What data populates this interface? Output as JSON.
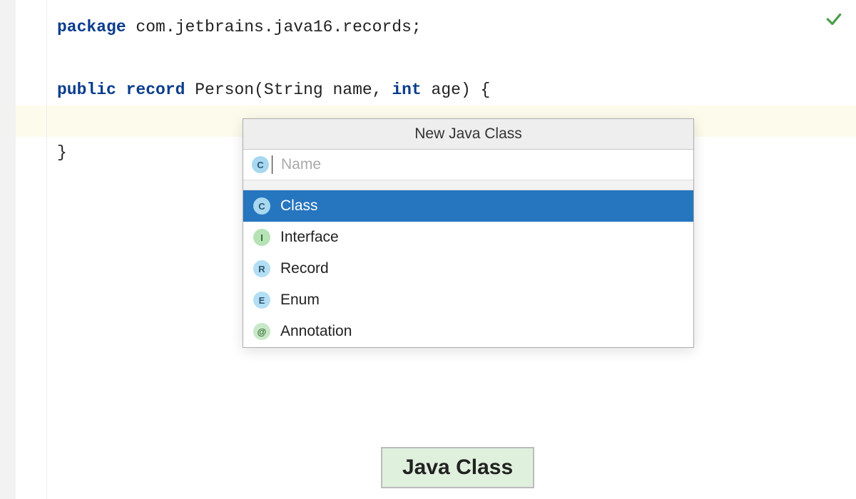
{
  "code": {
    "package_kw": "package",
    "package_name": " com.jetbrains.java16.records;",
    "public_kw": "public",
    "record_kw": " record",
    "record_sig_1": " Person(String name, ",
    "int_kw": "int",
    "record_sig_2": " age) {",
    "close_brace": "}"
  },
  "status": {
    "ok_color": "#4a9e4a"
  },
  "dialog": {
    "title": "New Java Class",
    "input_placeholder": "Name",
    "input_value": "",
    "input_icon_letter": "C",
    "items": [
      {
        "icon_letter": "C",
        "icon_class": "icon-c",
        "label": "Class",
        "selected": true
      },
      {
        "icon_letter": "I",
        "icon_class": "icon-i",
        "label": "Interface",
        "selected": false
      },
      {
        "icon_letter": "R",
        "icon_class": "icon-r",
        "label": "Record",
        "selected": false
      },
      {
        "icon_letter": "E",
        "icon_class": "icon-e",
        "label": "Enum",
        "selected": false
      },
      {
        "icon_letter": "@",
        "icon_class": "icon-at",
        "label": "Annotation",
        "selected": false
      }
    ]
  },
  "tooltip": {
    "label": "Java Class"
  }
}
